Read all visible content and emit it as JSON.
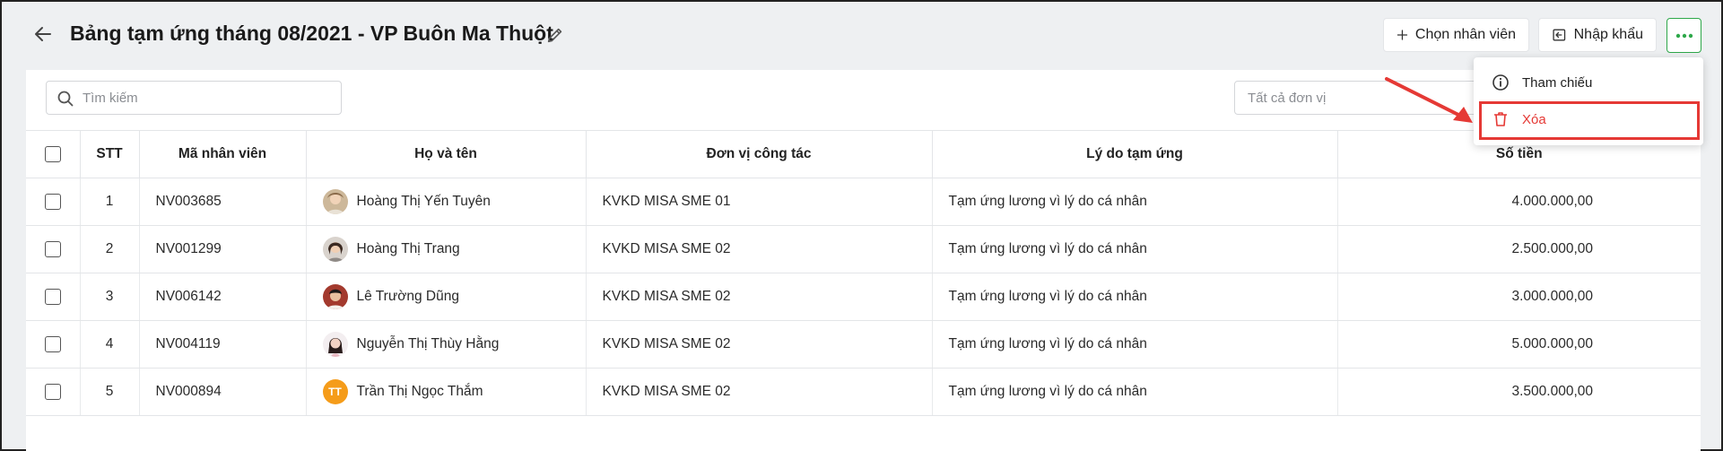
{
  "header": {
    "title": "Bảng tạm ứng tháng 08/2021 - VP Buôn Ma Thuột",
    "choose_employee_label": "Chọn nhân viên",
    "import_label": "Nhập khẩu"
  },
  "toolbar": {
    "search_placeholder": "Tìm kiếm",
    "unit_filter_placeholder": "Tất cả đơn vị"
  },
  "menu": {
    "reference_label": "Tham chiếu",
    "delete_label": "Xóa"
  },
  "table": {
    "columns": [
      "STT",
      "Mã nhân viên",
      "Họ và tên",
      "Đơn vị công tác",
      "Lý do tạm ứng",
      "Số tiền"
    ],
    "rows": [
      {
        "stt": "1",
        "code": "NV003685",
        "name": "Hoàng Thị Yến Tuyên",
        "unit": "KVKD MISA SME 01",
        "reason": "Tạm ứng lương vì lý do cá nhân",
        "amount": "4.000.000,00",
        "avatar": "photo"
      },
      {
        "stt": "2",
        "code": "NV001299",
        "name": "Hoàng Thị Trang",
        "unit": "KVKD MISA SME 02",
        "reason": "Tạm ứng lương vì lý do cá nhân",
        "amount": "2.500.000,00",
        "avatar": "photo"
      },
      {
        "stt": "3",
        "code": "NV006142",
        "name": "Lê Trường Dũng",
        "unit": "KVKD MISA SME 02",
        "reason": "Tạm ứng lương vì lý do cá nhân",
        "amount": "3.000.000,00",
        "avatar": "photo"
      },
      {
        "stt": "4",
        "code": "NV004119",
        "name": "Nguyễn Thị Thùy Hằng",
        "unit": "KVKD MISA SME 02",
        "reason": "Tạm ứng lương vì lý do cá nhân",
        "amount": "5.000.000,00",
        "avatar": "photo"
      },
      {
        "stt": "5",
        "code": "NV000894",
        "name": "Trần Thị Ngọc Thắm",
        "unit": "KVKD MISA SME 02",
        "reason": "Tạm ứng lương vì lý do cá nhân",
        "amount": "3.500.000,00",
        "avatar_initials": "TT"
      }
    ]
  },
  "colors": {
    "accent_green": "#2ea84a",
    "danger_red": "#e53935",
    "avatar_orange": "#f59c1a"
  }
}
